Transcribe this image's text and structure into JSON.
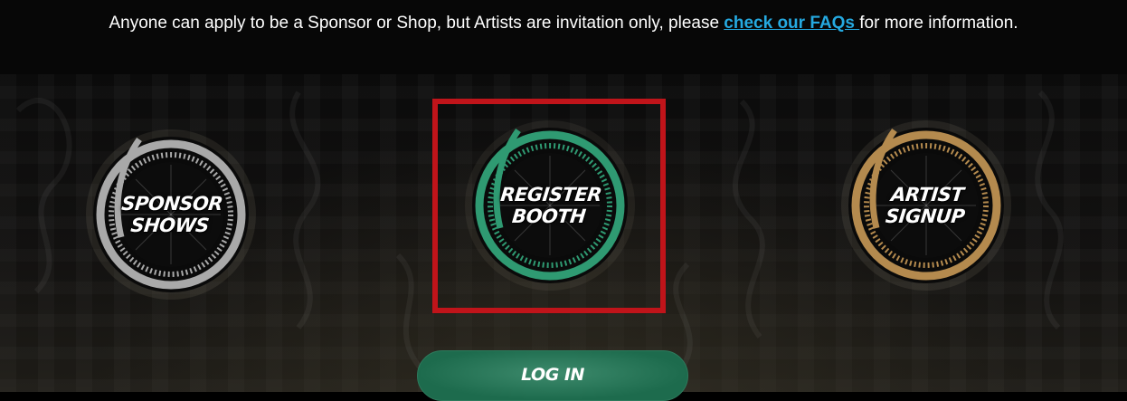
{
  "notice": {
    "text_before": "Anyone can apply to be a Sponsor or Shop, but Artists are invitation only, please ",
    "link_text": "check our FAQs ",
    "text_after": "for more information."
  },
  "badges": [
    {
      "line1": "SPONSOR",
      "line2": "SHOWS",
      "ring_color": "#a9a9a9"
    },
    {
      "line1": "REGISTER",
      "line2": "BOOTH",
      "ring_color": "#2f9a72"
    },
    {
      "line1": "ARTIST",
      "line2": "SIGNUP",
      "ring_color": "#b48a4e"
    }
  ],
  "highlight_color": "#c0141a",
  "login": {
    "label": "LOG IN"
  },
  "colors": {
    "link": "#25a9e0",
    "login_button": "#1f6e50"
  }
}
